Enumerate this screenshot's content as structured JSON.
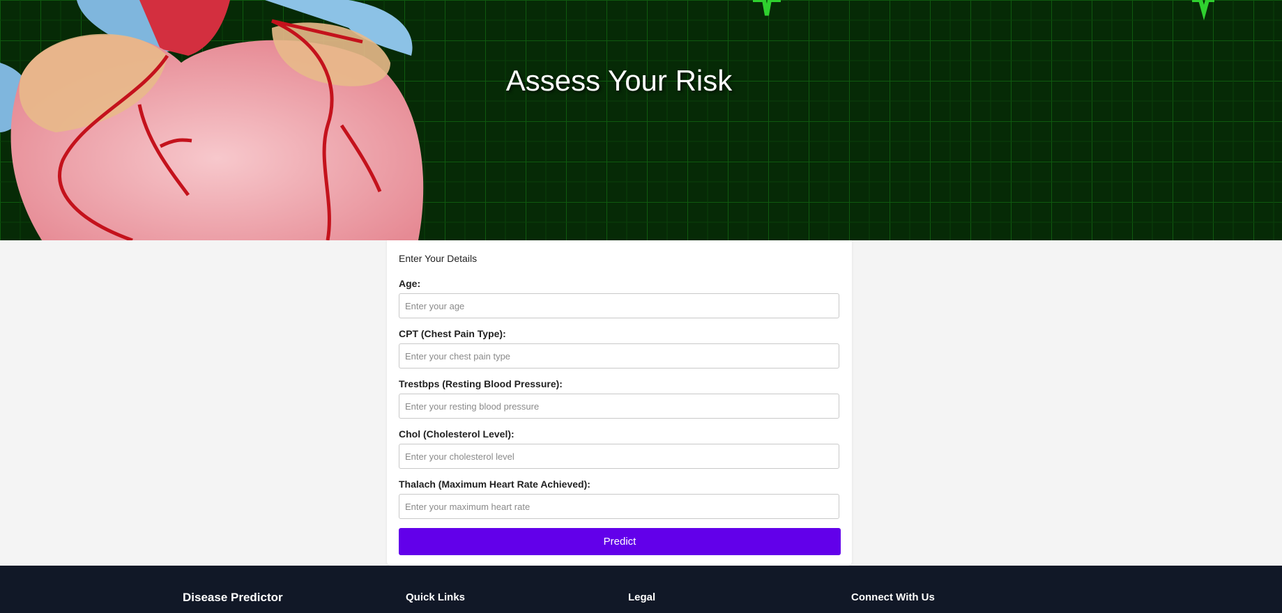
{
  "hero": {
    "title": "Assess Your Risk"
  },
  "form": {
    "heading": "Enter Your Details",
    "fields": [
      {
        "label": "Age:",
        "placeholder": "Enter your age",
        "value": ""
      },
      {
        "label": "CPT (Chest Pain Type):",
        "placeholder": "Enter your chest pain type",
        "value": ""
      },
      {
        "label": "Trestbps (Resting Blood Pressure):",
        "placeholder": "Enter your resting blood pressure",
        "value": ""
      },
      {
        "label": "Chol (Cholesterol Level):",
        "placeholder": "Enter your cholesterol level",
        "value": ""
      },
      {
        "label": "Thalach (Maximum Heart Rate Achieved):",
        "placeholder": "Enter your maximum heart rate",
        "value": ""
      }
    ],
    "submit_label": "Predict"
  },
  "footer": {
    "brand": "Disease Predictor",
    "quick_links": "Quick Links",
    "legal": "Legal",
    "connect": "Connect With Us"
  },
  "colors": {
    "accent": "#6200ea",
    "footer_bg": "#111827",
    "hero_grid": "#0b4a0b",
    "page_bg": "#f4f4f4"
  }
}
